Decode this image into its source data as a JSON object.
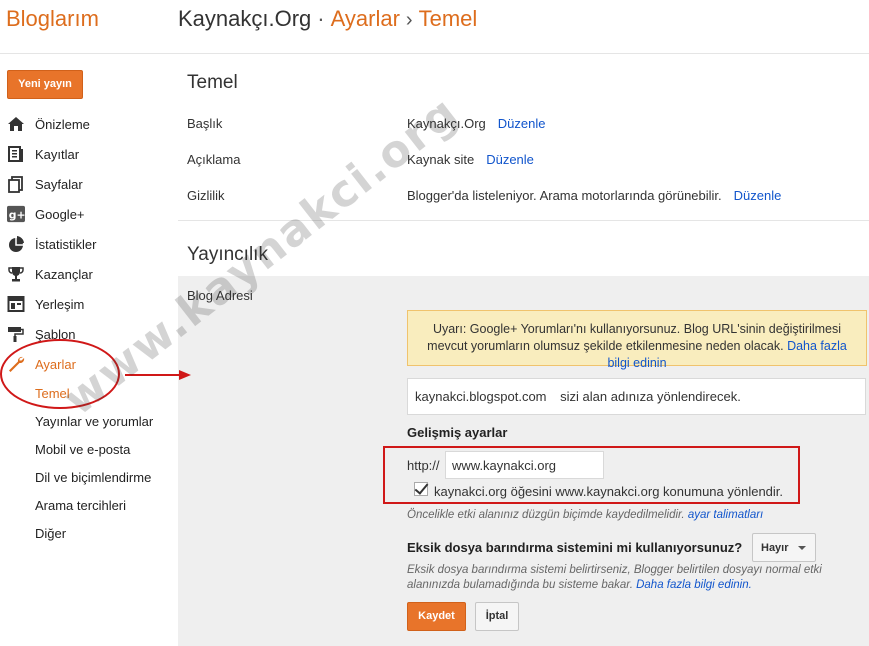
{
  "header": {
    "brand": "Bloglarım",
    "breadcrumb": {
      "blog": "Kaynakçı.Org",
      "sep1": "·",
      "section": "Ayarlar",
      "sep2": "›",
      "page": "Temel"
    }
  },
  "sidebar": {
    "new_post": "Yeni yayın",
    "items": [
      {
        "label": "Önizleme",
        "icon": "home-icon"
      },
      {
        "label": "Kayıtlar",
        "icon": "posts-icon"
      },
      {
        "label": "Sayfalar",
        "icon": "pages-icon"
      },
      {
        "label": "Google+",
        "icon": "google-plus-icon"
      },
      {
        "label": "İstatistikler",
        "icon": "pie-chart-icon"
      },
      {
        "label": "Kazançlar",
        "icon": "trophy-icon"
      },
      {
        "label": "Yerleşim",
        "icon": "layout-icon"
      },
      {
        "label": "Şablon",
        "icon": "paint-roller-icon"
      },
      {
        "label": "Ayarlar",
        "icon": "wrench-icon"
      }
    ],
    "sub_items": [
      "Temel",
      "Yayınlar ve yorumlar",
      "Mobil ve e-posta",
      "Dil ve biçimlendirme",
      "Arama tercihleri",
      "Diğer"
    ]
  },
  "main": {
    "basic": {
      "title": "Temel",
      "rows": [
        {
          "label": "Başlık",
          "value": "Kaynakçı.Org",
          "edit": "Düzenle"
        },
        {
          "label": "Açıklama",
          "value": "Kaynak site",
          "edit": "Düzenle"
        },
        {
          "label": "Gizlilik",
          "value": "Blogger'da listeleniyor. Arama motorlarında görünebilir.",
          "edit": "Düzenle"
        }
      ]
    },
    "publishing": {
      "title": "Yayıncılık",
      "blog_address_label": "Blog Adresi",
      "warning_text": "Uyarı: Google+ Yorumları'nı kullanıyorsunuz. Blog URL'sinin değiştirilmesi mevcut yorumların olumsuz şekilde etkilenmesine neden olacak.",
      "warning_link": "Daha fazla bilgi edinin",
      "blogspot_address": "kaynakci.blogspot.com",
      "redirect_note": "sizi alan adınıza yönlendirecek.",
      "advanced_title": "Gelişmiş ayarlar",
      "http_prefix": "http://",
      "custom_domain": "www.kaynakci.org",
      "redirect_checkbox_label": "kaynakci.org öğesini www.kaynakci.org konumuna yönlendir.",
      "redirect_checked": true,
      "hint_text": "Öncelikle etki alanınız düzgün biçimde kaydedilmelidir.",
      "hint_link": "ayar talimatları",
      "fallback_question": "Eksik dosya barındırma sistemini mi kullanıyorsunuz?",
      "fallback_select": "Hayır",
      "fallback_desc": "Eksik dosya barındırma sistemi belirtirseniz, Blogger belirtilen dosyayı normal etki alanınızda bulamadığında bu sisteme bakar.",
      "fallback_link": "Daha fazla bilgi edinin.",
      "save": "Kaydet",
      "cancel": "İptal"
    }
  },
  "watermark": "www.kaynakci.org",
  "colors": {
    "accent": "#dd6d1d",
    "link": "#1155cc",
    "annotation": "#d01818",
    "warning_bg": "#f9edbe"
  }
}
